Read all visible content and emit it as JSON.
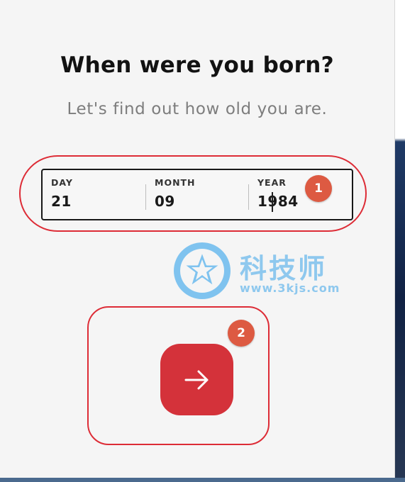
{
  "form": {
    "title": "When were you born?",
    "subtitle": "Let's find out how old you are.",
    "fields": [
      {
        "label": "DAY",
        "value": "21"
      },
      {
        "label": "MONTH",
        "value": "09"
      },
      {
        "label": "YEAR",
        "value": "1984"
      }
    ]
  },
  "annotations": {
    "badge_1": "1",
    "badge_2": "2"
  },
  "next_button": {
    "icon": "arrow-right-icon"
  },
  "watermark": {
    "logo": "star-logo",
    "text": "科技师",
    "url": "www.3kjs.com"
  },
  "colors": {
    "accent": "#d4323a",
    "annotation": "#dd2c36",
    "badge": "#dd5a42"
  }
}
